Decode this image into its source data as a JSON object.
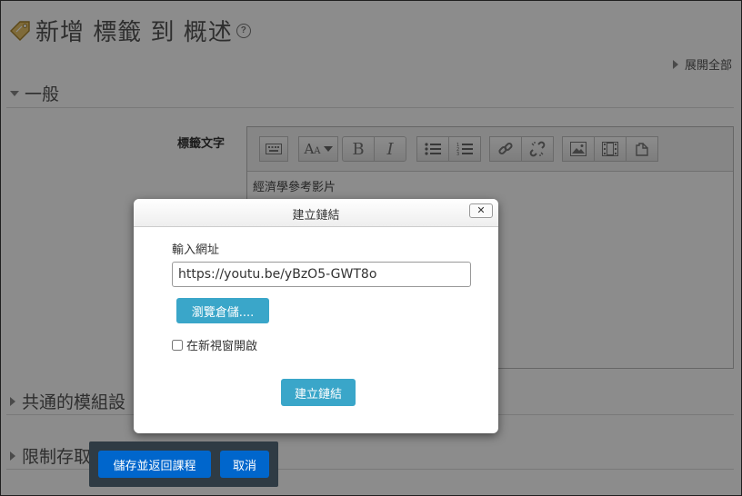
{
  "page": {
    "title": "新增 標籤 到 概述",
    "help_icon": "question-circle-icon",
    "expand_all": "展開全部"
  },
  "sections": {
    "general": "一般",
    "common_module": "共通的模組設",
    "restrict_access": "限制存取"
  },
  "form": {
    "label_text": "標籤文字",
    "editor_content": "經濟學參考影片",
    "toolbar_icons": [
      "toggle-toolbar-icon",
      "font-style-icon",
      "bold-icon",
      "italic-icon",
      "unordered-list-icon",
      "ordered-list-icon",
      "link-icon",
      "unlink-icon",
      "image-icon",
      "media-icon",
      "manage-files-icon"
    ]
  },
  "modal": {
    "title": "建立鏈結",
    "close_label": "✕",
    "url_label": "輸入網址",
    "url_value": "https://youtu.be/yBzO5-GWT8o",
    "browse_button": "瀏覽倉儲....",
    "new_window_label": "在新視窗開啟",
    "new_window_checked": false,
    "create_button": "建立鏈結"
  },
  "footer": {
    "save_return": "儲存並返回課程",
    "cancel": "取消"
  },
  "colors": {
    "primary": "#0066cc",
    "info": "#3aa6c9",
    "sticky_bg": "#2f3b44"
  }
}
